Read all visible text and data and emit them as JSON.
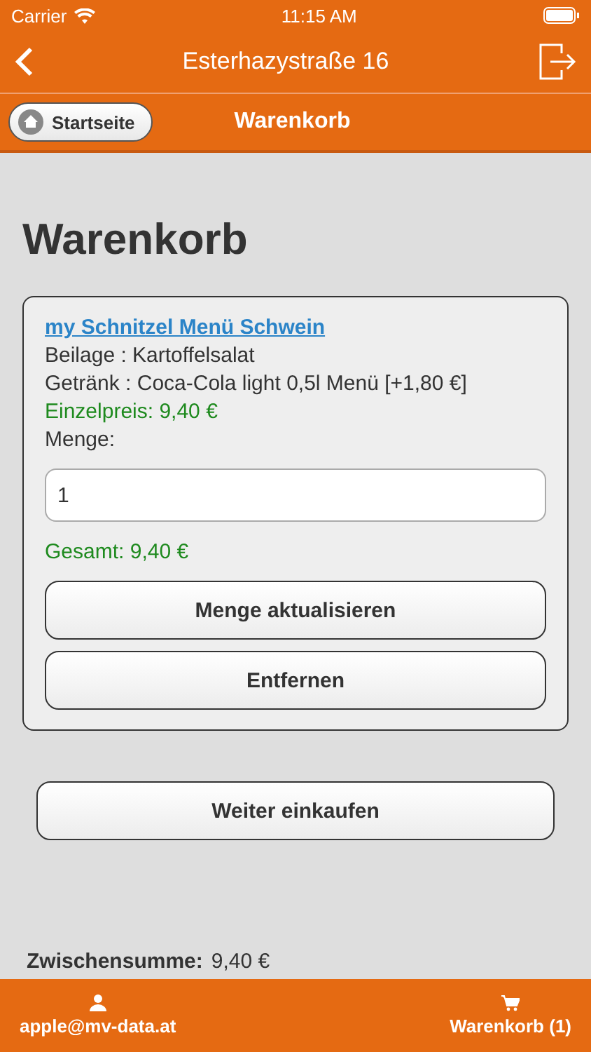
{
  "status_bar": {
    "carrier": "Carrier",
    "time": "11:15 AM"
  },
  "nav": {
    "title": "Esterhazystraße 16"
  },
  "subbar": {
    "home_button": "Startseite",
    "title": "Warenkorb"
  },
  "heading": "Warenkorb",
  "cart_items": [
    {
      "name": "my Schnitzel Menü Schwein",
      "details": [
        "Beilage : Kartoffelsalat",
        "Getränk : Coca-Cola light 0,5l Menü [+1,80 €]"
      ],
      "unit_price": "Einzelpreis: 9,40 €",
      "quantity_label": "Menge:",
      "quantity": "1",
      "total": "Gesamt: 9,40 €",
      "buttons": [
        "Menge aktualisieren",
        "Entfernen"
      ]
    }
  ],
  "continue_button": "Weiter einkaufen",
  "subtotal": {
    "label": "Zwischensumme:",
    "value": "9,40 €"
  },
  "footer": {
    "account": "apple@mv-data.at",
    "cart": "Warenkorb (1)"
  }
}
